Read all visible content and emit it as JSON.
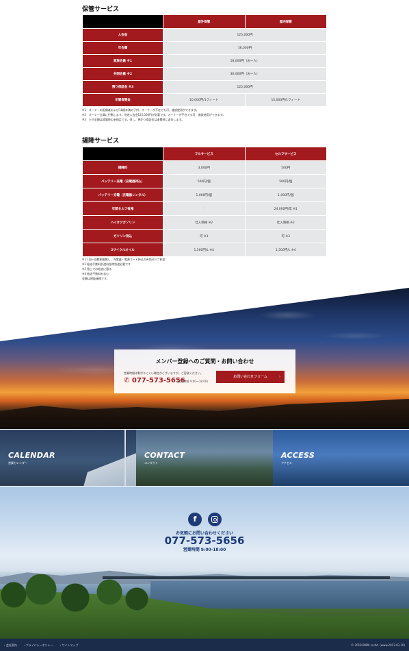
{
  "storage": {
    "title": "保管サービス",
    "headers": [
      "屋外保管",
      "屋内保管"
    ],
    "rows": [
      {
        "label": "入会金",
        "values": [
          "125,000円"
        ],
        "merged": true
      },
      {
        "label": "年会費",
        "values": [
          "36,000円"
        ],
        "merged": true
      },
      {
        "label": "家族会員 ※1",
        "values": [
          "18,000円（お一人）"
        ],
        "merged": true
      },
      {
        "label": "共同会員 ※2",
        "values": [
          "36,000円（お一人）"
        ],
        "merged": true
      },
      {
        "label": "預り保証金 ※3",
        "values": [
          "125,000円"
        ],
        "merged": true
      },
      {
        "label": "年間保管金",
        "values": [
          "10,000円/1フィート",
          "15,000円/1フィート"
        ],
        "merged": false
      }
    ],
    "notes": [
      "※1　オーナーの配偶者および18歳未満の子供、オーナーが不在でも可、施設使用ができます。",
      "※2　オーナー全員に行動します。別途入会金125,000円が必要です。オーナーが不在でも可、施設使用ができます。",
      "※3　土日全額は就場時の未指定です。但し、預かり保証金は退費時に返金します。"
    ]
  },
  "launch": {
    "title": "揚降サービス",
    "headers": [
      "フルサービス",
      "セルフサービス"
    ],
    "rows": [
      {
        "label": "揚降料",
        "values": [
          "3,000円",
          "500円"
        ]
      },
      {
        "label": "バッテリー充電（充電器持込）",
        "values": [
          "500円/個",
          "500円/個"
        ]
      },
      {
        "label": "バッテリー充電（充電器レンタル）",
        "values": [
          "1,000円/個",
          "1,000円/個"
        ]
      },
      {
        "label": "年間セルフ有権",
        "values": [
          "-",
          "24,000円/年 ※1"
        ]
      },
      {
        "label": "ハイオクガソリン",
        "values": [
          "仕入価格 ※2",
          "仕入価格 ※2"
        ]
      },
      {
        "label": "ガソリン持込",
        "values": [
          "可 ※3",
          "可 ※3"
        ]
      },
      {
        "label": "2サイクルオイル",
        "values": [
          "1,500円/L ※4",
          "1,500円/L ※4"
        ]
      }
    ],
    "notes": [
      "※1 1回～回数制限無し、充電器・電源コード持込の有効セルフ料金",
      "※2 給油手数料別途料金時別途必要です",
      "※3 限上での給油に限る",
      "※4 給油手数料を含む",
      "金額は税抜価格です。"
    ]
  },
  "contact_box": {
    "title": "メンバー登録へのご質問・お問い合わせ",
    "note": "営業時間は繋がりにくい場合がございますが、ご容赦ください。",
    "phone": "077-573-5656",
    "hours": "(受付時間 9:00～18:00)",
    "button": "お問い合わせフォーム"
  },
  "tiles": [
    {
      "title": "CALENDAR",
      "sub": "営業カレンダー"
    },
    {
      "title": "CONTACT",
      "sub": "コンタクト"
    },
    {
      "title": "ACCESS",
      "sub": "アクセス"
    }
  ],
  "footer": {
    "invite": "お気軽にお問い合わせください",
    "phone": "077-573-5656",
    "hours": "営業時間 9:00-18:00",
    "links": [
      "会社案内",
      "プライバシーポリシー",
      "サイトマップ"
    ],
    "copyright": "© 2019 BIWA co.ltd. (www.2013.03.10)"
  }
}
